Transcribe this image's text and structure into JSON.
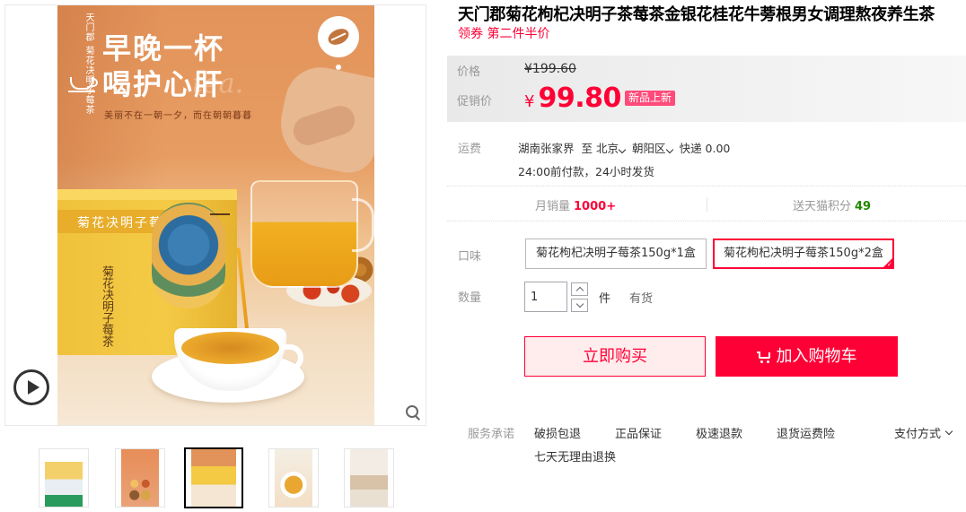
{
  "product": {
    "title": "天门郡菊花枸杞决明子茶莓茶金银花桂花牛蒡根男女调理熬夜养生茶",
    "subtitle": "领券 第二件半价"
  },
  "poster": {
    "brand_vertical": "天门郡 菊花决明子莓茶",
    "headline_line1": "早晚一杯",
    "headline_line2": "喝护心肝",
    "watermark": "tea.",
    "slogan": "美丽不在一朝一夕，而在朝朝暮暮",
    "box_title": "菊花决明子莓茶",
    "box_side_title": "菊花决明子莓茶"
  },
  "price": {
    "orig_label": "价格",
    "orig_value": "¥199.60",
    "promo_label": "促销价",
    "currency": "¥",
    "promo_value": "99.80",
    "badge": "新品上新"
  },
  "shipping": {
    "label": "运费",
    "from": "湖南张家界",
    "to_prefix": "至",
    "city": "北京",
    "district": "朝阳区",
    "express": "快递 0.00",
    "note": "24:00前付款，24小时发货"
  },
  "stats": {
    "monthly_sales_label": "月销量",
    "monthly_sales_value": "1000+",
    "points_label": "送天猫积分",
    "points_value": "49"
  },
  "sku": {
    "label": "口味",
    "options": [
      "菊花枸杞决明子莓茶150g*1盒",
      "菊花枸杞决明子莓茶150g*2盒"
    ],
    "selected_index": 1
  },
  "quantity": {
    "label": "数量",
    "value": "1",
    "unit": "件",
    "stock": "有货"
  },
  "actions": {
    "buy_now": "立即购买",
    "add_to_cart": "加入购物车"
  },
  "service": {
    "label": "服务承诺",
    "items": [
      "破损包退",
      "正品保证",
      "极速退款",
      "退货运费险"
    ],
    "extra": "七天无理由退换",
    "payment": "支付方式"
  },
  "colors": {
    "accent": "#ff0036",
    "badge": "#ff4a7a",
    "points": "#228800"
  }
}
